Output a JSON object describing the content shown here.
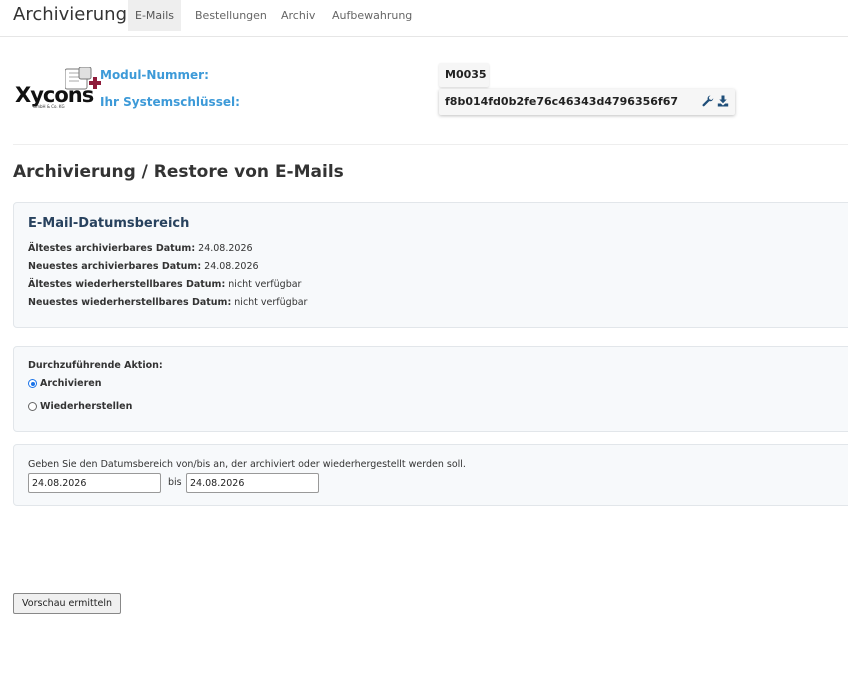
{
  "header": {
    "brand": "Archivierung",
    "tabs": [
      {
        "label": "E-Mails",
        "active": true
      },
      {
        "label": "Bestellungen",
        "active": false
      },
      {
        "label": "Archiv",
        "active": false
      },
      {
        "label": "Aufbewahrung",
        "active": false
      }
    ]
  },
  "module": {
    "logo_text": "Xycons",
    "logo_sub": "GmbH & Co. KG",
    "modul_label": "Modul-Nummer:",
    "modul_value": "M0035",
    "key_label": "Ihr Systemschlüssel:",
    "key_value": "f8b014fd0b2fe76c46343d4796356f67",
    "icons": [
      "wrench-icon",
      "download-icon"
    ]
  },
  "page_title": "Archivierung / Restore von E-Mails",
  "date_range_panel": {
    "title": "E-Mail-Datumsbereich",
    "lines": [
      {
        "label": "Ältestes archivierbares Datum:",
        "value": "24.08.2026"
      },
      {
        "label": "Neuestes archivierbares Datum:",
        "value": "24.08.2026"
      },
      {
        "label": "Ältestes wiederherstellbares Datum:",
        "value": "nicht verfügbar"
      },
      {
        "label": "Neuestes wiederherstellbares Datum:",
        "value": "nicht verfügbar"
      }
    ]
  },
  "action_panel": {
    "label": "Durchzuführende Aktion:",
    "options": [
      {
        "label": "Archivieren",
        "checked": true
      },
      {
        "label": "Wiederherstellen",
        "checked": false
      }
    ]
  },
  "range_input_panel": {
    "instruction": "Geben Sie den Datumsbereich von/bis an, der archiviert oder wiederhergestellt werden soll.",
    "from_value": "24.08.2026",
    "bis_label": "bis",
    "to_value": "24.08.2026"
  },
  "preview_button": "Vorschau ermitteln",
  "colors": {
    "accent_blue": "#3d9ad8",
    "panel_title": "#28425e",
    "radio_checked": "#1a73e8"
  }
}
